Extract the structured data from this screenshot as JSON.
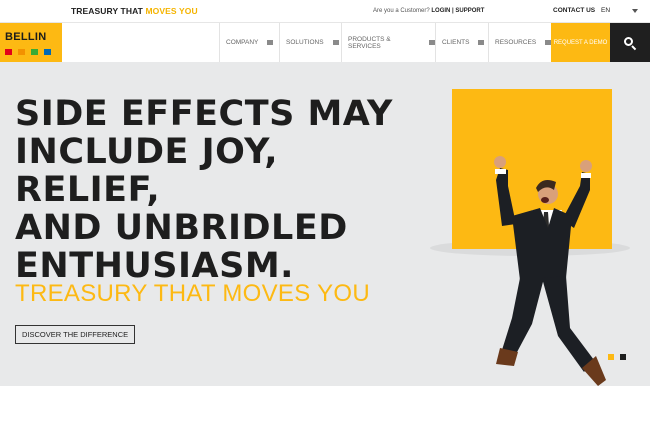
{
  "topbar": {
    "tagline_start": "TREASURY THAT ",
    "tagline_highlight": "MOVES YOU",
    "customer_question": "Are you a Customer?",
    "login": "LOGIN",
    "separator": " | ",
    "support": "SUPPORT",
    "contact": "CONTACT US",
    "language": "EN"
  },
  "logo": {
    "text": "BELLIN",
    "squares": [
      "#e2001a",
      "#f39200",
      "#3aaa35",
      "#0069b4"
    ]
  },
  "nav": {
    "items": [
      "COMPANY",
      "SOLUTIONS",
      "PRODUCTS & SERVICES",
      "CLIENTS",
      "RESOURCES"
    ],
    "demo": "REQUEST A DEMO",
    "search_icon": "search-icon"
  },
  "hero": {
    "headline_lines": [
      "SIDE EFFECTS MAY",
      "INCLUDE JOY, RELIEF,",
      "AND UNBRIDLED",
      "ENTHUSIASM."
    ],
    "subheadline": "TREASURY THAT MOVES YOU",
    "cta": "DISCOVER THE DIFFERENCE",
    "slider_active": 1,
    "slider_count": 2
  },
  "colors": {
    "brand_yellow": "#fdb913",
    "dark": "#1e1e1e",
    "hero_bg": "#e8e9ea"
  }
}
